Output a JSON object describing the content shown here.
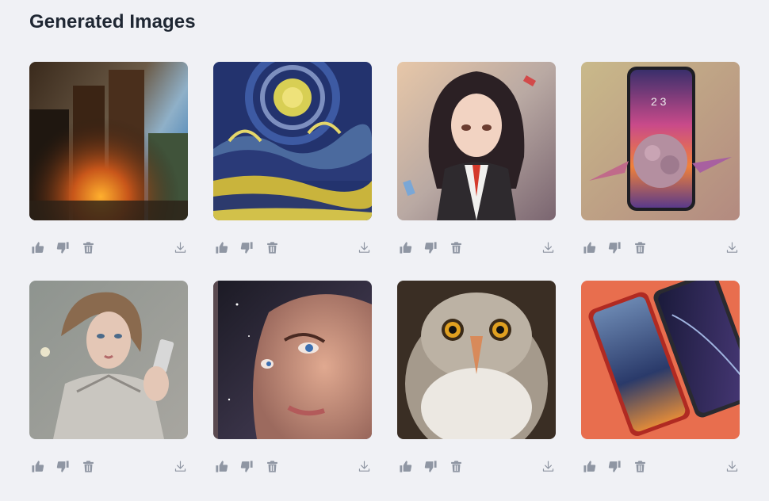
{
  "page": {
    "title": "Generated Images"
  },
  "images": [
    {
      "subject": "forest-fire-landscape",
      "actions": [
        "like",
        "dislike",
        "delete",
        "download"
      ]
    },
    {
      "subject": "starry-night-style-swirls",
      "actions": [
        "like",
        "dislike",
        "delete",
        "download"
      ]
    },
    {
      "subject": "anime-girl-portrait",
      "actions": [
        "like",
        "dislike",
        "delete",
        "download"
      ]
    },
    {
      "subject": "smartphone-with-purple-creature",
      "actions": [
        "like",
        "dislike",
        "delete",
        "download"
      ]
    },
    {
      "subject": "woman-holding-phone",
      "actions": [
        "like",
        "dislike",
        "delete",
        "download"
      ]
    },
    {
      "subject": "closeup-face-blue-eyes",
      "actions": [
        "like",
        "dislike",
        "delete",
        "download"
      ]
    },
    {
      "subject": "owl-portrait",
      "actions": [
        "like",
        "dislike",
        "delete",
        "download"
      ]
    },
    {
      "subject": "two-smartphones-on-orange",
      "actions": [
        "like",
        "dislike",
        "delete",
        "download"
      ]
    }
  ],
  "icons": {
    "like": "thumbs-up-icon",
    "dislike": "thumbs-down-icon",
    "delete": "trash-icon",
    "download": "download-icon"
  },
  "colors": {
    "background": "#f0f1f5",
    "title": "#1f2733",
    "icon": "#8f96a3"
  }
}
